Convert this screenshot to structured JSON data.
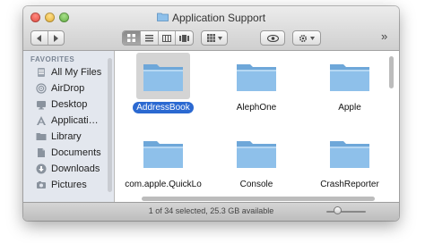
{
  "window": {
    "title": "Application Support"
  },
  "toolbar": {
    "back_icon": "chevron-left-icon",
    "forward_icon": "chevron-right-icon",
    "view_modes": [
      "icon-view",
      "list-view",
      "column-view",
      "coverflow-view"
    ],
    "active_view": "icon-view",
    "arrange_icon": "grid-icon",
    "quicklook_icon": "eye-icon",
    "action_icon": "gear-icon",
    "overflow_label": "»"
  },
  "sidebar": {
    "heading": "FAVORITES",
    "items": [
      {
        "label": "All My Files",
        "icon": "all-files-icon"
      },
      {
        "label": "AirDrop",
        "icon": "airdrop-icon"
      },
      {
        "label": "Desktop",
        "icon": "desktop-icon"
      },
      {
        "label": "Applicati…",
        "icon": "applications-icon"
      },
      {
        "label": "Library",
        "icon": "folder-icon"
      },
      {
        "label": "Documents",
        "icon": "documents-icon"
      },
      {
        "label": "Downloads",
        "icon": "downloads-icon"
      },
      {
        "label": "Pictures",
        "icon": "pictures-icon"
      }
    ]
  },
  "files": [
    {
      "name": "AddressBook",
      "selected": true
    },
    {
      "name": "AlephOne",
      "selected": false
    },
    {
      "name": "Apple",
      "selected": false
    },
    {
      "name": "com.apple.QuickLo",
      "selected": false
    },
    {
      "name": "Console",
      "selected": false
    },
    {
      "name": "CrashReporter",
      "selected": false
    }
  ],
  "status": {
    "text": "1 of 34 selected, 25.3 GB available"
  },
  "colors": {
    "selection": "#2b69d1",
    "sidebar_bg": "#e3e7ee",
    "folder": "#7fb2e0"
  }
}
